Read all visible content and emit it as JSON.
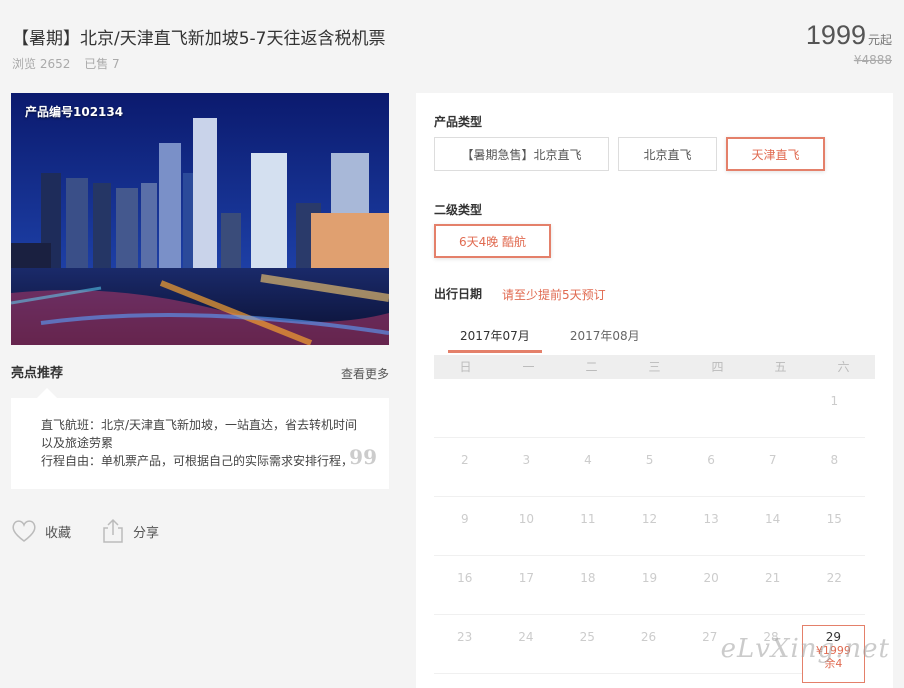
{
  "product": {
    "title": "【暑期】北京/天津直飞新加坡5-7天往返含税机票",
    "views": "浏览 2652",
    "sold": "已售 7",
    "price": "1999",
    "price_suffix": "元起",
    "old_price": "¥4888",
    "code": "产品编号102134"
  },
  "highlights": {
    "title": "亮点推荐",
    "more": "查看更多",
    "line1": "直飞航班：北京/天津直飞新加坡，一站直达，省去转机时间",
    "line2": "以及旅途劳累",
    "line3": "行程自由：单机票产品，可根据自己的实际需求安排行程，",
    "quote": "99"
  },
  "actions": {
    "favorite": "收藏",
    "share": "分享"
  },
  "booking": {
    "type_label": "产品类型",
    "types": [
      "【暑期急售】北京直飞",
      "北京直飞",
      "天津直飞"
    ],
    "selected_type": "天津直飞",
    "sub_label": "二级类型",
    "sub_types": [
      "6天4晚 酷航"
    ],
    "date_label": "出行日期",
    "date_note": "请至少提前5天预订",
    "months": [
      "2017年07月",
      "2017年08月"
    ],
    "weekdays": [
      "日",
      "一",
      "二",
      "三",
      "四",
      "五",
      "六"
    ],
    "weeks": [
      [
        "",
        "",
        "",
        "",
        "",
        "",
        "1"
      ],
      [
        "2",
        "3",
        "4",
        "5",
        "6",
        "7",
        "8"
      ],
      [
        "9",
        "10",
        "11",
        "12",
        "13",
        "14",
        "15"
      ],
      [
        "16",
        "17",
        "18",
        "19",
        "20",
        "21",
        "22"
      ],
      [
        "23",
        "24",
        "25",
        "26",
        "27",
        "28",
        "29"
      ]
    ],
    "special_day": {
      "day": "29",
      "price": "¥1999",
      "stock": "余4"
    }
  },
  "watermark": "eLvXing.net",
  "colors": {
    "accent": "#e4806a",
    "accent_text": "#e06a50"
  }
}
